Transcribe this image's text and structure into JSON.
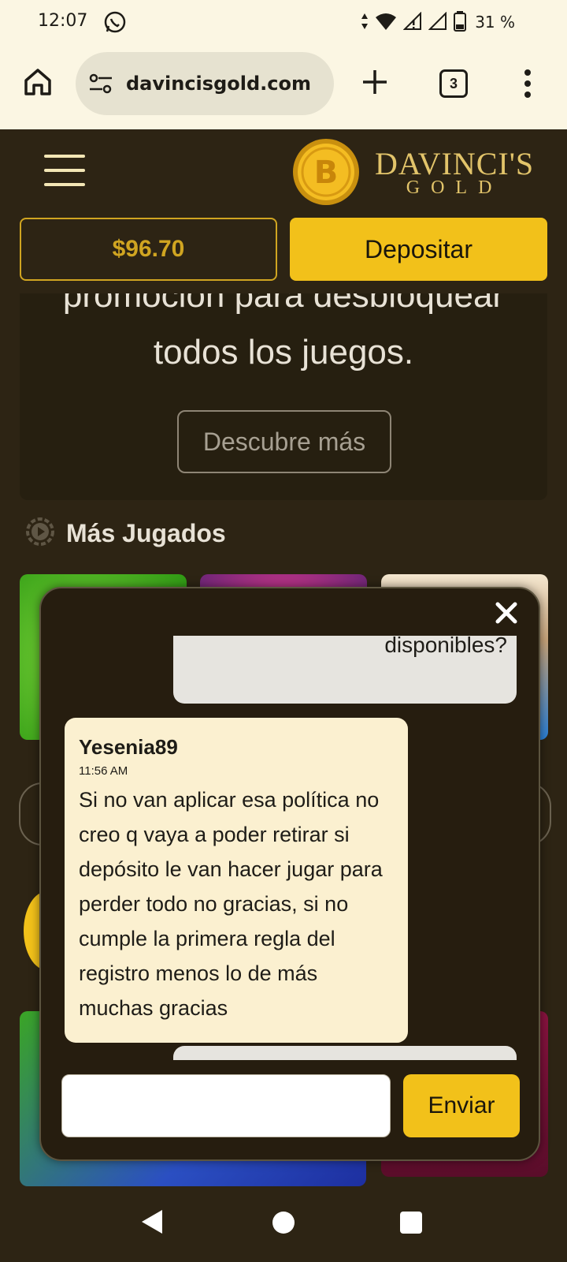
{
  "status_bar": {
    "time": "12:07",
    "battery": "31 %",
    "icons": [
      "whatsapp-icon",
      "data-arrows-icon",
      "wifi-icon",
      "signal-alert-icon",
      "signal-icon",
      "battery-icon"
    ]
  },
  "browser": {
    "url": "davincisgold.com",
    "tab_count": "3",
    "icons": [
      "home-icon",
      "site-settings-icon",
      "new-tab-icon",
      "tabs-icon",
      "more-icon"
    ]
  },
  "site": {
    "logo_line1": "DAVINCI'S",
    "logo_line2": "GOLD",
    "balance": "$96.70",
    "deposit_label": "Depositar",
    "promo_line1": "promoción para desbloquear",
    "promo_line2": "todos los juegos.",
    "discover_label": "Descubre más",
    "section_title": "Más Jugados"
  },
  "chat": {
    "messages": [
      {
        "direction": "outgoing",
        "text": "disponibles?"
      },
      {
        "direction": "incoming",
        "user": "Yesenia89",
        "time": "11:56 AM",
        "text": "Si no van aplicar esa política no creo q vaya a poder retirar si depósito le van hacer jugar para perder todo no gracias, si no cumple la primera regla del registro menos lo de más muchas gracias"
      }
    ],
    "input_placeholder": "",
    "send_label": "Enviar"
  },
  "colors": {
    "background": "#2d2414",
    "accent": "#f2c11a",
    "balance_gold": "#d0a521",
    "incoming_bubble": "#fbf0d0",
    "outgoing_bubble": "#e6e4df"
  }
}
